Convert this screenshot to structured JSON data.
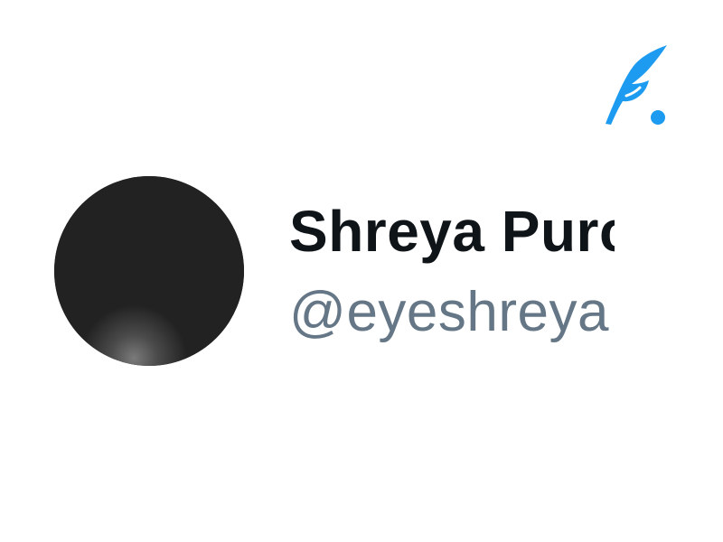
{
  "app": {
    "logo_icon": "quill-feather-dot-icon",
    "accent_color": "#1d9bf0"
  },
  "profile": {
    "display_name": "Shreya Purc",
    "handle": "@eyeshreya",
    "handle_color": "#657786",
    "name_color": "#0f1419",
    "avatar_color": "#222222"
  }
}
